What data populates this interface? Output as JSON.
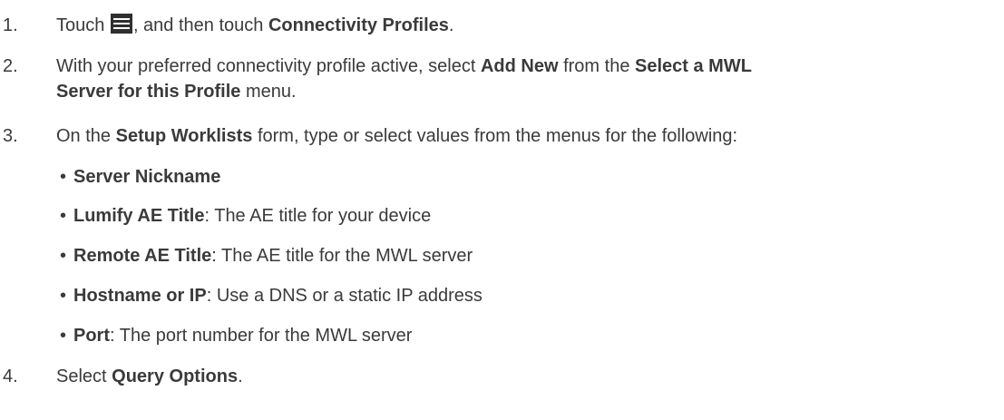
{
  "steps": [
    {
      "number": "1.",
      "before_icon": "Touch ",
      "icon": "menu-icon",
      "after_icon": ", and then touch ",
      "bold": "Connectivity Profiles",
      "end": "."
    },
    {
      "number": "2.",
      "part1": "With your preferred connectivity profile active, select ",
      "bold1": "Add New",
      "part2": " from the ",
      "bold2_line1": "Select a MWL",
      "bold2_line2": "Server for this Profile",
      "part3": " menu."
    },
    {
      "number": "3.",
      "part1": "On the ",
      "bold1": "Setup Worklists",
      "part2": " form, type or select values from the menus for the following:",
      "bullets": [
        {
          "symbol": "•",
          "label": "Server Nickname",
          "desc": ""
        },
        {
          "symbol": "•",
          "label": "Lumify AE Title",
          "desc": ": The AE title for your device"
        },
        {
          "symbol": "•",
          "label": "Remote AE Title",
          "desc": ": The AE title for the MWL server"
        },
        {
          "symbol": "•",
          "label": "Hostname or IP",
          "desc": ": Use a DNS or a static IP address"
        },
        {
          "symbol": "•",
          "label": "Port",
          "desc": ": The port number for the MWL server"
        }
      ]
    },
    {
      "number": "4.",
      "part1": "Select ",
      "bold1": "Query Options",
      "end": "."
    }
  ]
}
